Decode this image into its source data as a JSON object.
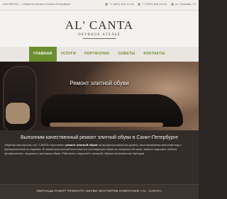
{
  "topbar": {
    "info": "АЛЬ'КАНТА — Обувное ателье в Санкт-Петербурге",
    "contact_1": "+7 (921) 316-14-43",
    "contact_2": "+7 (921) 316-14-43",
    "contact_3": "ул. Осипова, 13"
  },
  "brand": {
    "logo": "AL' CANTA",
    "subtitle": "ОБУВНОЕ АТЕЛЬЕ"
  },
  "nav": {
    "items": [
      "ГЛАВНАЯ",
      "УСЛУГИ",
      "ПОРТФОЛИО",
      "СОВЕТЫ",
      "КОНТАКТЫ"
    ]
  },
  "hero": {
    "caption": "Ремонт элитной обуви"
  },
  "about": {
    "title": "Выполним качественный ремонт элитной обуви в Санкт-Петербурге",
    "text_1": "Обувная мастерская «AL' CANTA» выполняет",
    "text_bold": "ремонт элитной обуви",
    "text_2": "на профессиональном уровне, восстанавливая внешний вид и функциональность изделия. В нашей мастерской выполняется реставрация обуви из натуральной кожи, замена подошвы, набоек, профилактика, покраска и растяжка обуви. Работаем с мужской и женской обувью премиальных брендов."
  },
  "works": {
    "label": "ОБРАЗЦЫ РАБОТ РЕМОНТА ОБУВИ МАСТЕРОВ КОМПАНИИ «AL' CANTA»"
  },
  "colors": {
    "nav_active": "#6b8f2f",
    "nav_text": "#6c8b2f",
    "brand_bg": "#f4f2ef"
  }
}
